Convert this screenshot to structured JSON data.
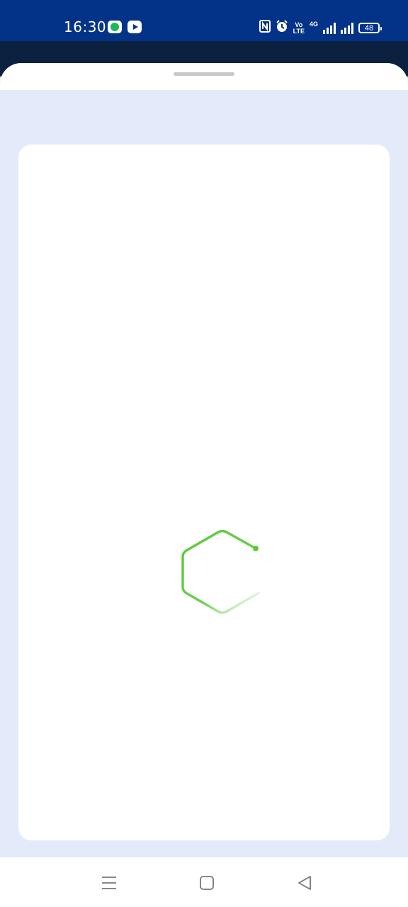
{
  "status_bar": {
    "time": "16:30",
    "app_icons": [
      "spotify-icon",
      "youtube-icon"
    ],
    "system_icons": [
      "nfc-icon",
      "alarm-icon",
      "volte-icon",
      "signal-4g-icon",
      "signal-icon",
      "battery-icon"
    ],
    "volte_top": "Vo",
    "volte_bottom": "LTE",
    "network_type": "4G",
    "battery_level": "48"
  },
  "colors": {
    "status_bar_bg": "#023388",
    "page_bg": "#e3eaf9",
    "spinner_accent": "#5cc83a"
  },
  "loading_spinner": {
    "icon": "hexagon-spinner-icon"
  },
  "nav_bar": {
    "buttons": [
      "menu-icon",
      "home-icon",
      "back-icon"
    ]
  }
}
